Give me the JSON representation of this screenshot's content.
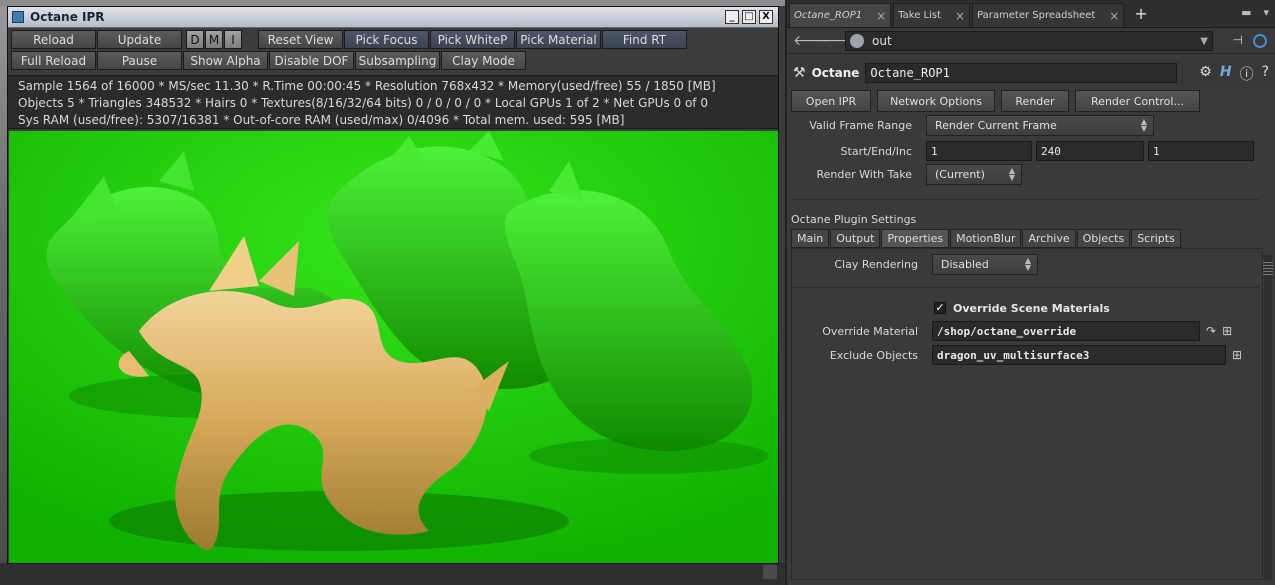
{
  "ipr": {
    "title": "Octane IPR",
    "controls": {
      "minimize": "_",
      "maximize": "□",
      "close": "X"
    },
    "row1": [
      {
        "label": "Reload",
        "style": "gray"
      },
      {
        "label": "Update",
        "style": "gray"
      },
      {
        "label": "D",
        "style": "small"
      },
      {
        "label": "M",
        "style": "small"
      },
      {
        "label": "I",
        "style": "small"
      },
      {
        "label": "Reset View",
        "style": "gray"
      },
      {
        "label": "Pick Focus",
        "style": "blue"
      },
      {
        "label": "Pick WhiteP",
        "style": "blue"
      },
      {
        "label": "Pick Material",
        "style": "blue"
      },
      {
        "label": "Find RT",
        "style": "blue"
      }
    ],
    "row2": [
      {
        "label": "Full Reload",
        "style": "gray"
      },
      {
        "label": "Pause",
        "style": "gray"
      },
      {
        "label": "Show Alpha",
        "style": "gray"
      },
      {
        "label": "Disable DOF",
        "style": "gray"
      },
      {
        "label": "Subsampling",
        "style": "gray"
      },
      {
        "label": "Clay Mode",
        "style": "gray"
      }
    ],
    "stats": [
      "Sample 1564 of 16000 * MS/sec 11.30 * R.Time 00:00:45 * Resolution 768x432 * Memory(used/free) 55 / 1850 [MB]",
      "Objects 5 * Triangles 348532 * Hairs 0 * Textures(8/16/32/64 bits) 0 / 0 / 0 / 0 * Local GPUs 1 of 2 * Net GPUs 0 of 0",
      "Sys RAM (used/free): 5307/16381 * Out-of-core RAM (used/max) 0/4096 * Total mem. used: 595 [MB]"
    ],
    "render": {
      "background_color": "#17c300",
      "green_dragon_color": "#2bd81a",
      "gold_dragon_color": "#e0b86a"
    }
  },
  "panel": {
    "tabs": [
      {
        "label": "Octane_ROP1",
        "active": true
      },
      {
        "label": "Take List",
        "active": false
      },
      {
        "label": "Parameter Spreadsheet",
        "active": false
      }
    ],
    "path": "out",
    "node_type": "Octane",
    "node_name": "Octane_ROP1",
    "actions": [
      "Open IPR",
      "Network Options",
      "Render",
      "Render Control..."
    ],
    "valid_frame_range": {
      "label": "Valid Frame Range",
      "value": "Render Current Frame"
    },
    "start_end_inc": {
      "label": "Start/End/Inc",
      "start": "1",
      "end": "240",
      "inc": "1"
    },
    "render_with_take": {
      "label": "Render With Take",
      "value": "(Current)"
    },
    "section": "Octane Plugin Settings",
    "param_tabs": [
      "Main",
      "Output",
      "Properties",
      "MotionBlur",
      "Archive",
      "Objects",
      "Scripts"
    ],
    "active_param_tab": "Properties",
    "clay_rendering": {
      "label": "Clay Rendering",
      "value": "Disabled"
    },
    "override_scene_materials": {
      "label": "Override Scene Materials",
      "checked": true
    },
    "override_material": {
      "label": "Override Material",
      "value": "/shop/octane_override"
    },
    "exclude_objects": {
      "label": "Exclude Objects",
      "value": "dragon_uv_multisurface3"
    },
    "accent_color": "#4a8dd0"
  }
}
